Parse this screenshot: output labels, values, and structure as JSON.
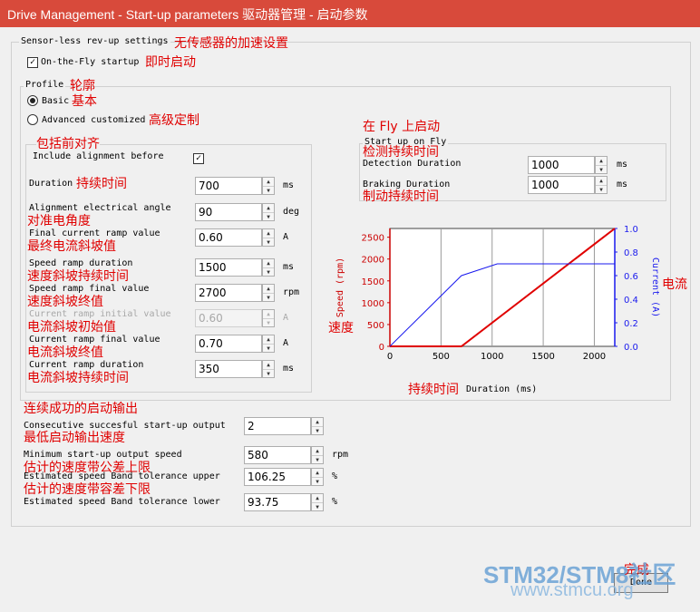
{
  "window": {
    "title": "Drive Management - Start-up parameters 驱动器管理 - 启动参数"
  },
  "sensorless": {
    "group_label": "Sensor-less rev-up settings",
    "group_ann": "无传感器的加速设置",
    "otf_label": "On-the-Fly startup",
    "otf_ann": "即时启动",
    "otf_checked": true
  },
  "profile": {
    "label": "Profile",
    "ann": "轮廓",
    "basic_label": "Basic",
    "basic_ann": "基本",
    "advanced_label": "Advanced customized",
    "advanced_ann": "高级定制",
    "selected": "basic"
  },
  "alignment": {
    "ann": "包括前对齐",
    "include_label": "Include alignment before",
    "include_checked": true
  },
  "params": [
    {
      "label": "Duration",
      "ann": "持续时间",
      "value": "700",
      "unit": "ms",
      "enabled": true
    },
    {
      "label": "Alignment electrical angle",
      "ann": "对准电角度",
      "value": "90",
      "unit": "deg",
      "enabled": true
    },
    {
      "label": "Final current ramp value",
      "ann": "最终电流斜坡值",
      "value": "0.60",
      "unit": "A",
      "enabled": true
    },
    {
      "label": "Speed ramp duration",
      "ann": "速度斜坡持续时间",
      "value": "1500",
      "unit": "ms",
      "enabled": true
    },
    {
      "label": "Speed ramp final value",
      "ann": "速度斜坡终值",
      "value": "2700",
      "unit": "rpm",
      "enabled": true
    },
    {
      "label": "Current ramp initial value",
      "ann": "电流斜坡初始值",
      "value": "0.60",
      "unit": "A",
      "enabled": false
    },
    {
      "label": "Current ramp final value",
      "ann": "电流斜坡终值",
      "value": "0.70",
      "unit": "A",
      "enabled": true
    },
    {
      "label": "Current ramp duration",
      "ann": "电流斜坡持续时间",
      "value": "350",
      "unit": "ms",
      "enabled": true
    }
  ],
  "fly": {
    "ann": "在 Fly 上启动",
    "group_label": "Start up on Fly",
    "det_label": "Detection Duration",
    "det_ann": "检测持续时间",
    "det_value": "1000",
    "det_unit": "ms",
    "brk_label": "Braking Duration",
    "brk_ann": "制动持续时间",
    "brk_value": "1000",
    "brk_unit": "ms"
  },
  "output": {
    "ann": "连续成功的启动输出",
    "rows": [
      {
        "label": "Consecutive succesful start-up output",
        "ann": "最低启动输出速度",
        "value": "2",
        "unit": ""
      },
      {
        "label": "Minimum start-up output speed",
        "ann": "估计的速度带公差上限",
        "value": "580",
        "unit": "rpm"
      },
      {
        "label": "Estimated speed Band tolerance upper",
        "ann": "估计的速度带容差下限",
        "value": "106.25",
        "unit": "%"
      },
      {
        "label": "Estimated speed Band tolerance lower",
        "ann": "",
        "value": "93.75",
        "unit": "%"
      }
    ]
  },
  "done_label": "Done",
  "done_ann": "完成",
  "watermark": {
    "line1a": "STM32/",
    "line1b": "STM8",
    "line1c": "社区",
    "line2": "www.stmcu.org"
  },
  "chart_data": {
    "type": "line",
    "xlabel": "Duration (ms)",
    "xlabel_ann": "持续时间",
    "ylabel": "Speed (rpm)",
    "ylabel_ann": "速度",
    "y2label": "Current (A)",
    "y2label_ann": "电流",
    "xlim": [
      0,
      2200
    ],
    "ylim": [
      0,
      2700
    ],
    "y2lim": [
      0,
      1.0
    ],
    "xticks": [
      0,
      500,
      1000,
      1500,
      2000
    ],
    "yticks": [
      0,
      500,
      1000,
      1500,
      2000,
      2500
    ],
    "y2ticks": [
      "0.0",
      "0.2",
      "0.4",
      "0.6",
      "0.8",
      "1.0"
    ],
    "grid": "vertical",
    "series": [
      {
        "axis": "left",
        "color": "#e00000",
        "x": [
          0,
          700,
          2200
        ],
        "y": [
          0,
          0,
          2700
        ]
      },
      {
        "axis": "right",
        "color": "#1a1aee",
        "x": [
          0,
          700,
          1050,
          2200
        ],
        "y": [
          0,
          0.6,
          0.7,
          0.7
        ]
      }
    ]
  }
}
